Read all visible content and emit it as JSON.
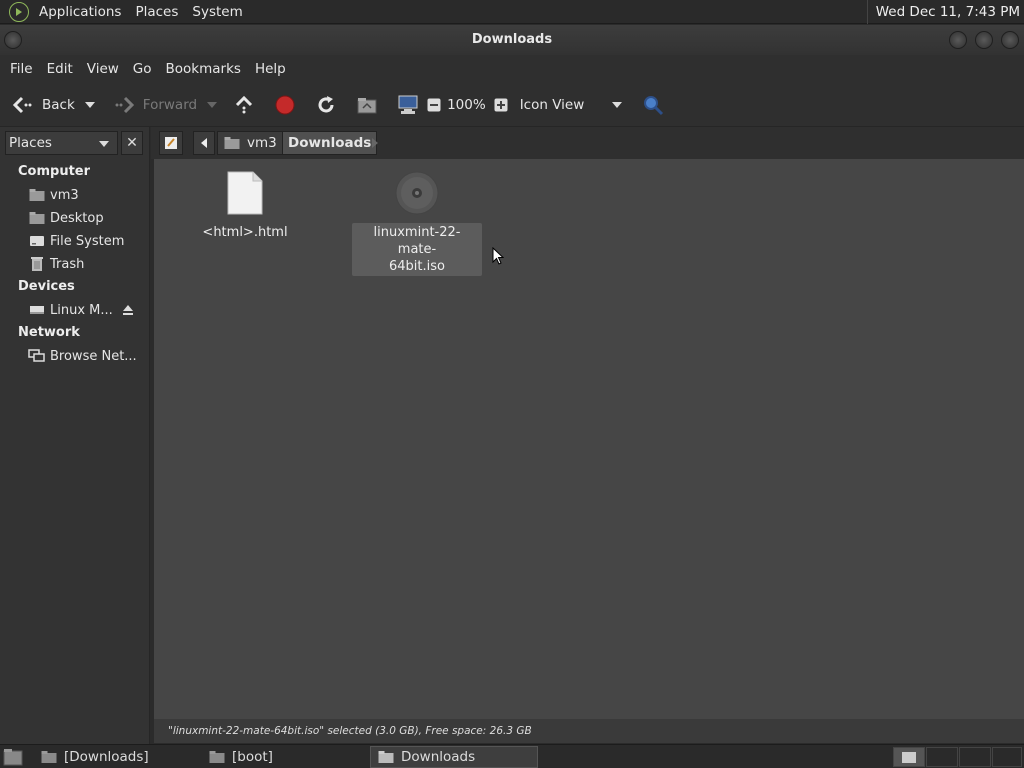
{
  "top_panel": {
    "menus": [
      "Applications",
      "Places",
      "System"
    ],
    "clock": "Wed Dec 11,  7:43 PM"
  },
  "window": {
    "title": "Downloads"
  },
  "menubar": [
    "File",
    "Edit",
    "View",
    "Go",
    "Bookmarks",
    "Help"
  ],
  "toolbar": {
    "back": "Back",
    "forward": "Forward",
    "zoom": "100%",
    "view_mode": "Icon View"
  },
  "sidebar": {
    "selector": "Places",
    "sections": {
      "computer": "Computer",
      "devices": "Devices",
      "network": "Network"
    },
    "computer_items": [
      "vm3",
      "Desktop",
      "File System",
      "Trash"
    ],
    "device_items": [
      "Linux M..."
    ],
    "network_items": [
      "Browse Net..."
    ]
  },
  "location": {
    "crumbs": [
      "vm3",
      "Downloads"
    ]
  },
  "files": [
    {
      "name": "<html>.html",
      "type": "html"
    },
    {
      "name_line1": "linuxmint-22-mate-",
      "name_line2": "64bit.iso",
      "type": "iso",
      "selected": true
    }
  ],
  "status": "\"linuxmint-22-mate-64bit.iso\" selected (3.0 GB), Free space: 26.3 GB",
  "taskbar": [
    "[Downloads]",
    "[boot]",
    "Downloads"
  ],
  "colors": {
    "bg": "#464646",
    "panel": "#2a2a2a",
    "stop_red": "#c42a2a",
    "mint_green": "#8fb85a"
  }
}
